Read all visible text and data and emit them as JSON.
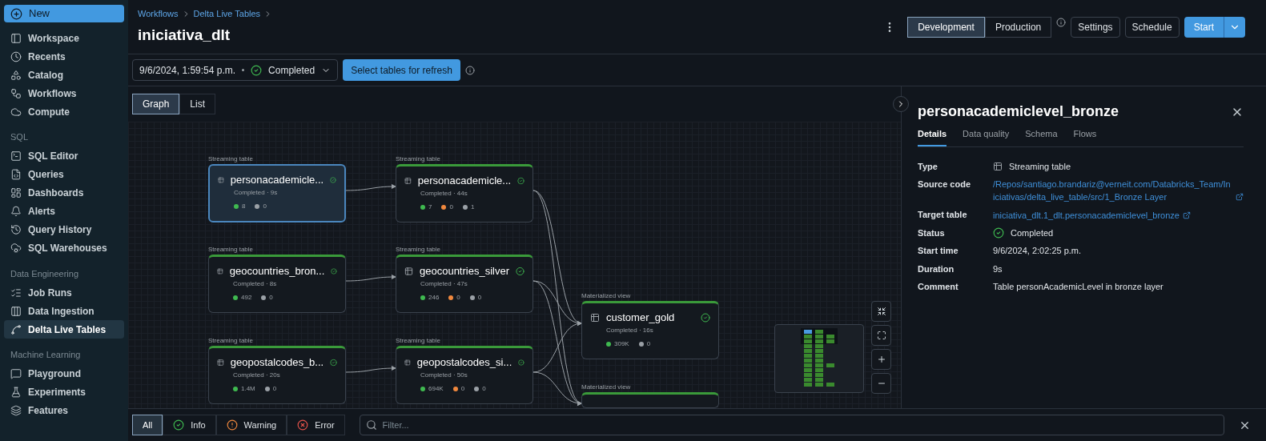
{
  "sidebar": {
    "new_button": "New",
    "sections": [
      {
        "items": [
          {
            "label": "Workspace",
            "selected": false
          },
          {
            "label": "Recents",
            "selected": false
          },
          {
            "label": "Catalog",
            "selected": false
          },
          {
            "label": "Workflows",
            "selected": false
          },
          {
            "label": "Compute",
            "selected": false
          }
        ]
      },
      {
        "title": "SQL",
        "items": [
          {
            "label": "SQL Editor",
            "selected": false
          },
          {
            "label": "Queries",
            "selected": false
          },
          {
            "label": "Dashboards",
            "selected": false
          },
          {
            "label": "Alerts",
            "selected": false
          },
          {
            "label": "Query History",
            "selected": false
          },
          {
            "label": "SQL Warehouses",
            "selected": false
          }
        ]
      },
      {
        "title": "Data Engineering",
        "items": [
          {
            "label": "Job Runs",
            "selected": false
          },
          {
            "label": "Data Ingestion",
            "selected": false
          },
          {
            "label": "Delta Live Tables",
            "selected": true
          }
        ]
      },
      {
        "title": "Machine Learning",
        "items": [
          {
            "label": "Playground",
            "selected": false
          },
          {
            "label": "Experiments",
            "selected": false
          },
          {
            "label": "Features",
            "selected": false
          }
        ]
      }
    ]
  },
  "breadcrumb": [
    "Workflows",
    "Delta Live Tables"
  ],
  "title": "iniciativa_dlt",
  "mode_tabs": [
    {
      "label": "Development",
      "selected": true
    },
    {
      "label": "Production",
      "selected": false
    }
  ],
  "actions": [
    "Settings",
    "Schedule"
  ],
  "start_button": "Start",
  "run_selector": {
    "time": "9/6/2024, 1:59:54 p.m.",
    "status": "Completed"
  },
  "refresh_button": "Select tables for refresh",
  "view_tabs": [
    {
      "label": "Graph",
      "selected": true
    },
    {
      "label": "List",
      "selected": false
    }
  ],
  "graph": {
    "nodes": [
      {
        "type": "Streaming table",
        "name": "personacademicle...",
        "status": "Completed · 9s",
        "selected": true,
        "counts": [
          {
            "value": "8",
            "color": "#3fb950"
          },
          {
            "value": "0",
            "color": "#9aa0a6"
          }
        ]
      },
      {
        "type": "Streaming table",
        "name": "personacademicle...",
        "status": "Completed · 44s",
        "selected": false,
        "counts": [
          {
            "value": "7",
            "color": "#3fb950"
          },
          {
            "value": "0",
            "color": "#f0883e"
          },
          {
            "value": "1",
            "color": "#9aa0a6"
          }
        ]
      },
      {
        "type": "Streaming table",
        "name": "geocountries_bron...",
        "status": "Completed · 8s",
        "selected": false,
        "counts": [
          {
            "value": "492",
            "color": "#3fb950"
          },
          {
            "value": "0",
            "color": "#9aa0a6"
          }
        ]
      },
      {
        "type": "Streaming table",
        "name": "geocountries_silver",
        "status": "Completed · 47s",
        "selected": false,
        "counts": [
          {
            "value": "246",
            "color": "#3fb950"
          },
          {
            "value": "0",
            "color": "#f0883e"
          },
          {
            "value": "0",
            "color": "#9aa0a6"
          }
        ]
      },
      {
        "type": "Streaming table",
        "name": "geopostalcodes_b...",
        "status": "Completed · 20s",
        "selected": false,
        "counts": [
          {
            "value": "1.4M",
            "color": "#3fb950"
          },
          {
            "value": "0",
            "color": "#9aa0a6"
          }
        ]
      },
      {
        "type": "Streaming table",
        "name": "geopostalcodes_si...",
        "status": "Completed · 50s",
        "selected": false,
        "counts": [
          {
            "value": "694K",
            "color": "#3fb950"
          },
          {
            "value": "0",
            "color": "#f0883e"
          },
          {
            "value": "0",
            "color": "#9aa0a6"
          }
        ]
      },
      {
        "type": "Materialized view",
        "name": "customer_gold",
        "status": "Completed · 16s",
        "selected": false,
        "counts": [
          {
            "value": "309K",
            "color": "#3fb950"
          },
          {
            "value": "0",
            "color": "#9aa0a6"
          }
        ]
      },
      {
        "type": "Materialized view",
        "selected": false
      }
    ]
  },
  "details": {
    "title": "personacademiclevel_bronze",
    "tabs": [
      {
        "label": "Details",
        "selected": true
      },
      {
        "label": "Data quality",
        "selected": false
      },
      {
        "label": "Schema",
        "selected": false
      },
      {
        "label": "Flows",
        "selected": false
      }
    ],
    "rows": [
      {
        "kind": "type",
        "label": "Type",
        "value": "Streaming table"
      },
      {
        "kind": "link",
        "label": "Source code",
        "value": "/Repos/santiago.brandariz@verneit.com/Databricks_Team/Iniciativas/delta_live_table/src/1_Bronze Layer"
      },
      {
        "kind": "link",
        "label": "Target table",
        "value": "iniciativa_dlt.1_dlt.personacademiclevel_bronze"
      },
      {
        "kind": "status",
        "label": "Status",
        "value": "Completed"
      },
      {
        "kind": "text",
        "label": "Start time",
        "value": "9/6/2024, 2:02:25 p.m."
      },
      {
        "kind": "text",
        "label": "Duration",
        "value": "9s"
      },
      {
        "kind": "text",
        "label": "Comment",
        "value": "Table personAcademicLevel in bronze layer"
      }
    ]
  },
  "log_filters": [
    {
      "kind": "all",
      "label": "All",
      "selected": true
    },
    {
      "kind": "info",
      "label": "Info",
      "selected": false
    },
    {
      "kind": "warning",
      "label": "Warning",
      "selected": false
    },
    {
      "kind": "error",
      "label": "Error",
      "selected": false
    }
  ],
  "filter": {
    "placeholder": "Filter..."
  }
}
